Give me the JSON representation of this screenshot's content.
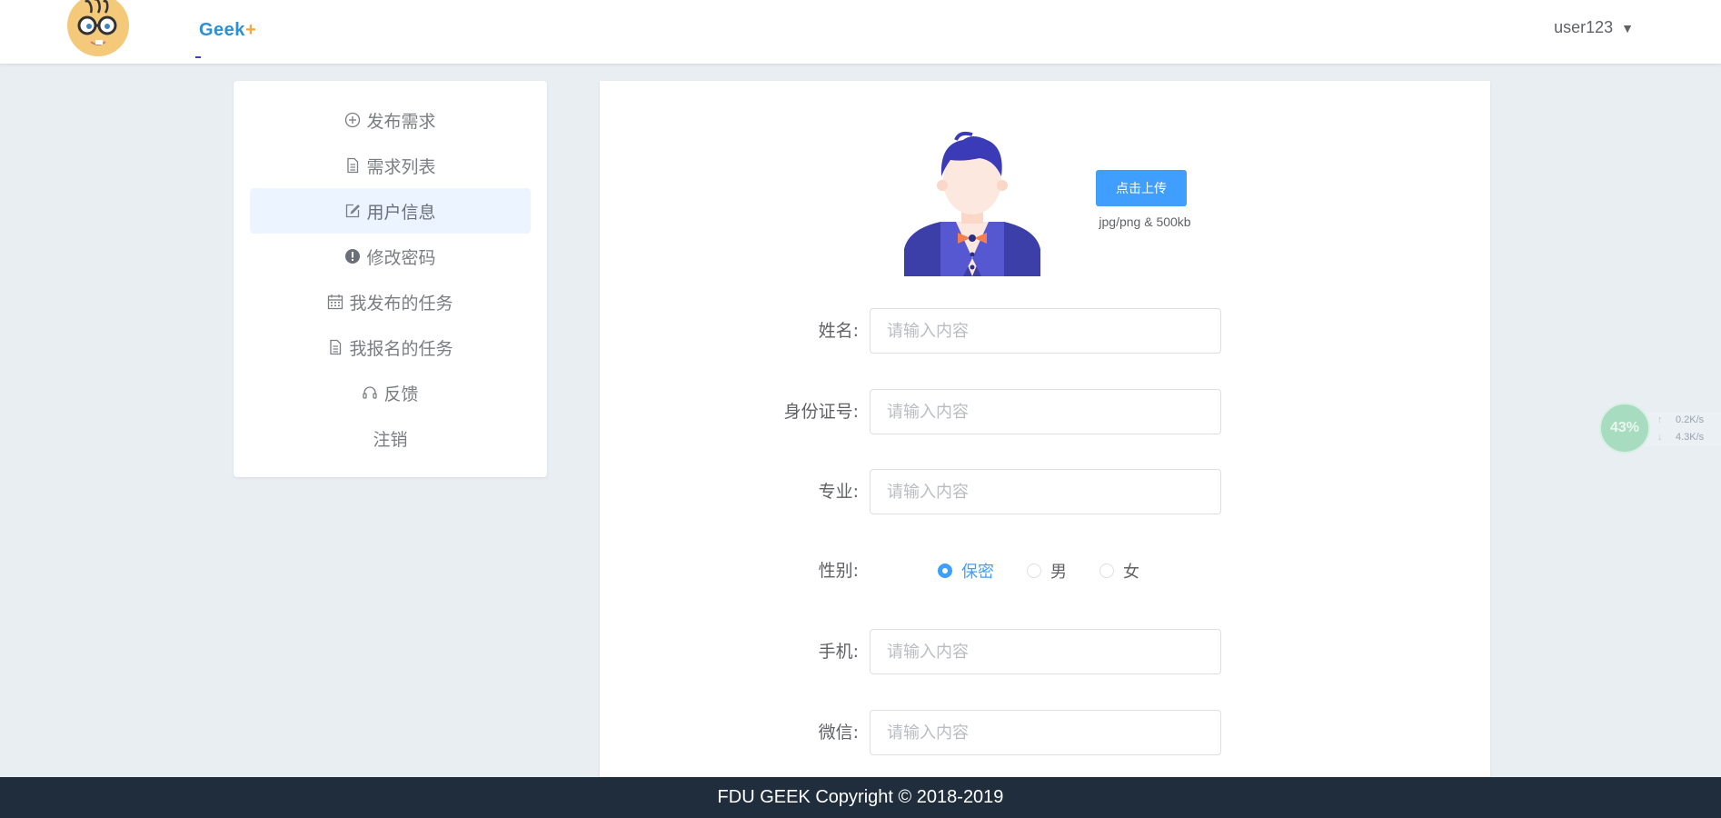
{
  "header": {
    "logo_text": "Geek",
    "logo_plus": "+",
    "username": "user123",
    "caret": "▼"
  },
  "sidebar": {
    "items": [
      {
        "label": "发布需求",
        "icon": "plus-circle-icon"
      },
      {
        "label": "需求列表",
        "icon": "document-icon"
      },
      {
        "label": "用户信息",
        "icon": "edit-icon",
        "active": true
      },
      {
        "label": "修改密码",
        "icon": "warning-icon"
      },
      {
        "label": "我发布的任务",
        "icon": "calendar-icon"
      },
      {
        "label": "我报名的任务",
        "icon": "document-icon"
      },
      {
        "label": "反馈",
        "icon": "headset-icon"
      },
      {
        "label": "注销",
        "icon": ""
      }
    ]
  },
  "profile": {
    "upload_button": "点击上传",
    "upload_tip": "jpg/png & 500kb",
    "fields": {
      "name": {
        "label": "姓名:",
        "placeholder": "请输入内容",
        "value": ""
      },
      "id_number": {
        "label": "身份证号:",
        "placeholder": "请输入内容",
        "value": ""
      },
      "major": {
        "label": "专业:",
        "placeholder": "请输入内容",
        "value": ""
      },
      "phone": {
        "label": "手机:",
        "placeholder": "请输入内容",
        "value": ""
      },
      "wechat": {
        "label": "微信:",
        "placeholder": "请输入内容",
        "value": ""
      }
    },
    "gender": {
      "label": "性别:",
      "options": [
        "保密",
        "男",
        "女"
      ],
      "selected": "保密"
    }
  },
  "footer": {
    "text": "FDU GEEK Copyright © 2018-2019"
  },
  "net_widget": {
    "percent": "43%",
    "up": "0.2K/s",
    "down": "4.3K/s"
  },
  "colors": {
    "primary": "#409eff",
    "footer_bg": "#1f2d3d",
    "page_bg": "#e9eef3",
    "active_item_bg": "#ecf5ff"
  }
}
